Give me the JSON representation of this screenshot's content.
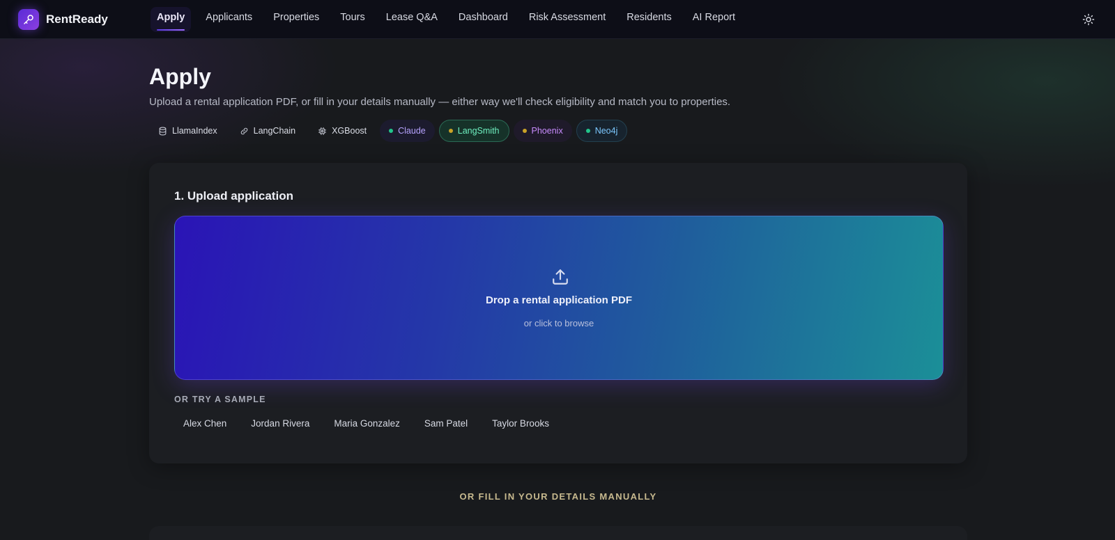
{
  "brand": {
    "name": "RentReady"
  },
  "nav": {
    "items": [
      {
        "label": "Apply",
        "active": true
      },
      {
        "label": "Applicants",
        "active": false
      },
      {
        "label": "Properties",
        "active": false
      },
      {
        "label": "Tours",
        "active": false
      },
      {
        "label": "Lease Q&A",
        "active": false
      },
      {
        "label": "Dashboard",
        "active": false
      },
      {
        "label": "Risk Assessment",
        "active": false
      },
      {
        "label": "Residents",
        "active": false
      },
      {
        "label": "AI Report",
        "active": false
      }
    ]
  },
  "header": {
    "title": "Apply",
    "subtitle": "Upload a rental application PDF, or fill in your details manually — either way we'll check eligibility and match you to properties."
  },
  "chips": [
    {
      "label": "LlamaIndex",
      "icon": "database-icon"
    },
    {
      "label": "LangChain",
      "icon": "link-icon"
    },
    {
      "label": "XGBoost",
      "icon": "chip-icon"
    },
    {
      "label": "Claude",
      "dot": "#22c58b"
    },
    {
      "label": "LangSmith",
      "dot": "#c9a227"
    },
    {
      "label": "Phoenix",
      "dot": "#c9a227"
    },
    {
      "label": "Neo4j",
      "dot": "#22c58b"
    }
  ],
  "upload": {
    "section_title": "1. Upload application",
    "drop_title": "Drop a rental application PDF",
    "drop_sub": "or click to browse",
    "sample_label": "OR TRY A SAMPLE",
    "samples": [
      "Alex Chen",
      "Jordan Rivera",
      "Maria Gonzalez",
      "Sam Patel",
      "Taylor Brooks"
    ]
  },
  "manual": {
    "label": "OR FILL IN YOUR DETAILS MANUALLY"
  },
  "colors": {
    "accent": "#6a4cf0",
    "teal": "#1b8f98",
    "background": "#181a1d"
  }
}
